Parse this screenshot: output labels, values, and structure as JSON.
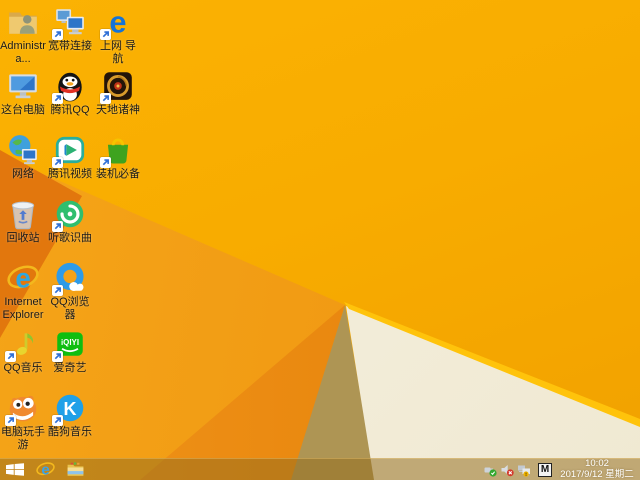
{
  "wallpaper": {
    "base_color": "#F8AC00",
    "mid_facet_color": "#F09914",
    "fold_color": "#E2770D",
    "deep_facet_color": "#E88309",
    "khaki_triangle_color": "#AE9554",
    "cream_triangle_color": "#F3EDDB",
    "edge_line_color": "#FFC30B"
  },
  "desktop": {
    "icons": [
      {
        "id": "user-folder",
        "label": "Administra...",
        "shortcut": false
      },
      {
        "id": "broadband",
        "label": "宽带连接",
        "shortcut": true
      },
      {
        "id": "web-nav",
        "label": "上网 导航",
        "shortcut": true
      },
      {
        "id": "this-pc",
        "label": "这台电脑",
        "shortcut": false
      },
      {
        "id": "tencent-qq",
        "label": "腾讯QQ",
        "shortcut": true
      },
      {
        "id": "game-tiandi",
        "label": "天地诸神",
        "shortcut": true
      },
      {
        "id": "network",
        "label": "网络",
        "shortcut": false
      },
      {
        "id": "tencent-video",
        "label": "腾讯视频",
        "shortcut": true
      },
      {
        "id": "zhuangji-bibei",
        "label": "装机必备",
        "shortcut": true
      },
      {
        "id": "recycle-bin",
        "label": "回收站",
        "shortcut": false
      },
      {
        "id": "music-recognition",
        "label": "听歌识曲",
        "shortcut": true
      },
      {
        "id": "internet-explorer",
        "label": "Internet Explorer",
        "shortcut": false
      },
      {
        "id": "qq-browser",
        "label": "QQ浏览器",
        "shortcut": true
      },
      {
        "id": "qq-music",
        "label": "QQ音乐",
        "shortcut": true
      },
      {
        "id": "iqiyi",
        "label": "爱奇艺",
        "shortcut": true
      },
      {
        "id": "pc-mobile-game",
        "label": "电脑玩手游",
        "shortcut": true
      },
      {
        "id": "kugou-music",
        "label": "酷狗音乐",
        "shortcut": true
      }
    ]
  },
  "taskbar": {
    "buttons": [
      {
        "id": "start-button",
        "icon": "windows-flag-icon"
      },
      {
        "id": "ie-taskbar",
        "icon": "internet-explorer-icon"
      },
      {
        "id": "explorer-taskbar",
        "icon": "file-explorer-icon"
      }
    ],
    "tray_icons": [
      "usb-safely-remove-icon",
      "volume-muted-icon",
      "network-warning-icon",
      "input-method-indicator"
    ],
    "input_method_label": "M"
  },
  "clock": {
    "time": "10:02",
    "date": "2017/9/12 星期二"
  }
}
